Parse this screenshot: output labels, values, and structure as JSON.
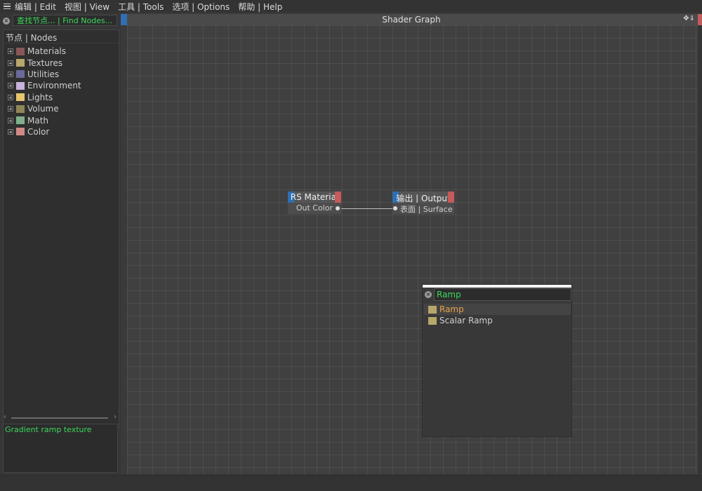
{
  "menu": [
    {
      "label": "编辑 | Edit"
    },
    {
      "label": "视图 | View"
    },
    {
      "label": "工具 | Tools"
    },
    {
      "label": "选项 | Options"
    },
    {
      "label": "帮助 | Help"
    }
  ],
  "search": {
    "value": "查找节点... | Find Nodes..."
  },
  "tree": {
    "header": "节点 | Nodes",
    "items": [
      {
        "label": "Materials",
        "color": "#8a5656"
      },
      {
        "label": "Textures",
        "color": "#b7a76a"
      },
      {
        "label": "Utilities",
        "color": "#6a6a9a"
      },
      {
        "label": "Environment",
        "color": "#c8b3dc"
      },
      {
        "label": "Lights",
        "color": "#e6c66e"
      },
      {
        "label": "Volume",
        "color": "#8e8656"
      },
      {
        "label": "Math",
        "color": "#7fb08a"
      },
      {
        "label": "Color",
        "color": "#d08a86"
      }
    ]
  },
  "description": "Gradient ramp texture",
  "graph": {
    "title": "Shader Graph",
    "tools_glyph": "✥⇓",
    "nodes": [
      {
        "title": "RS Material",
        "port": "Out Color",
        "head_color": "#2f6fb3"
      },
      {
        "title": "输出 | Output",
        "port": "表面 | Surface",
        "head_color": "#2f6fb3"
      }
    ]
  },
  "popup": {
    "query": "Ramp",
    "results": [
      {
        "label": "Ramp",
        "selected": true
      },
      {
        "label": "Scalar Ramp",
        "selected": false
      }
    ]
  },
  "colors": {
    "accent_green": "#3cd85a",
    "selected_orange": "#e8a24a",
    "node_red": "#c75a5a",
    "node_blue": "#2f6fb3"
  }
}
